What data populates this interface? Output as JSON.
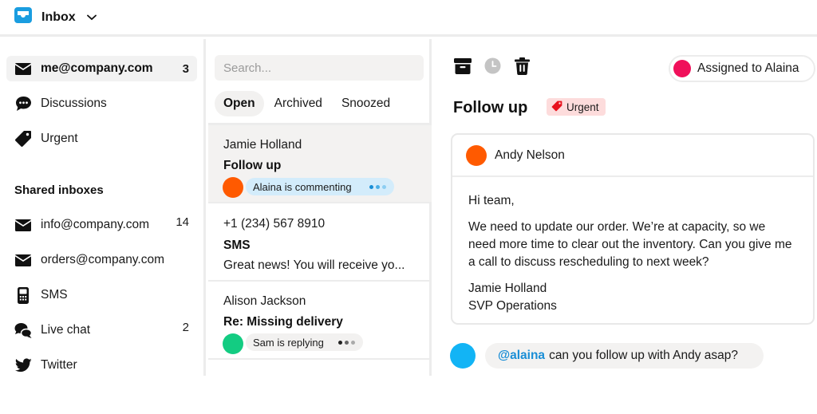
{
  "app": {
    "title": "Inbox",
    "brand_color": "#1a9de0"
  },
  "sidebar": {
    "items": [
      {
        "label": "me@company.com",
        "count": "3",
        "icon": "envelope-icon",
        "active": true
      },
      {
        "label": "Discussions",
        "count": "",
        "icon": "chat-bubble-icon"
      },
      {
        "label": "Urgent",
        "count": "",
        "icon": "tag-icon"
      }
    ],
    "shared_heading": "Shared inboxes",
    "shared_items": [
      {
        "label": "info@company.com",
        "count": "14",
        "icon": "envelope-icon"
      },
      {
        "label": "orders@company.com",
        "count": "",
        "icon": "envelope-icon"
      },
      {
        "label": "SMS",
        "count": "",
        "icon": "mobile-phone-icon"
      },
      {
        "label": "Live chat",
        "count": "2",
        "icon": "live-chat-icon"
      },
      {
        "label": "Twitter",
        "count": "",
        "icon": "twitter-bird-icon"
      }
    ]
  },
  "list": {
    "search_placeholder": "Search...",
    "tabs": [
      {
        "label": "Open",
        "active": true
      },
      {
        "label": "Archived"
      },
      {
        "label": "Snoozed"
      }
    ],
    "conversations": [
      {
        "from": "Jamie Holland",
        "subject": "Follow up",
        "status_text": "Alaina is commenting",
        "avatar_color": "#ff5a00",
        "pill_color": "#d3ecfb",
        "dot_colors": [
          "#1a8ed6",
          "#4aaee6",
          "#8ccdf2"
        ],
        "selected": true
      },
      {
        "from": "+1 (234) 567 8910",
        "subject": "SMS",
        "preview": "Great news! You will receive yo..."
      },
      {
        "from": "Alison Jackson",
        "subject": "Re: Missing delivery",
        "status_text": "Sam is replying",
        "avatar_color": "#13cc82",
        "pill_color": "#f2f1f0",
        "dot_colors": [
          "#222222",
          "#666666",
          "#aaaaaa"
        ]
      }
    ]
  },
  "detail": {
    "toolbar": [
      {
        "name": "archive",
        "icon": "archive-box-icon"
      },
      {
        "name": "snooze",
        "icon": "clock-icon"
      },
      {
        "name": "delete",
        "icon": "trash-icon"
      }
    ],
    "assignment": {
      "label": "Assigned to Alaina",
      "avatar_color": "#f0105a"
    },
    "title": "Follow up",
    "tag": {
      "label": "Urgent",
      "color": "#e8121e",
      "background": "#fddcdc"
    },
    "message": {
      "sender": "Andy Nelson",
      "avatar_color": "#ff5a00",
      "greeting": "Hi team,",
      "body": "We need to update our order. We’re at capacity, so we need more time to clear out the inventory. Can you give me a call to discuss rescheduling to next week?",
      "signature_name": "Jamie Holland",
      "signature_title": "SVP Operations"
    },
    "comment": {
      "avatar_color": "#12b4f5",
      "mention": "@alaina",
      "text": "can you follow up with Andy asap?"
    }
  }
}
